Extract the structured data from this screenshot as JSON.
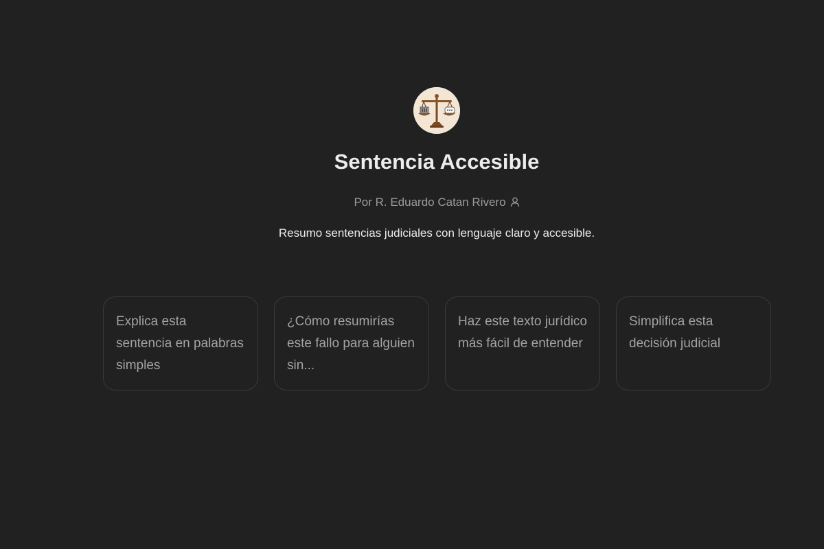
{
  "gpt": {
    "name": "Sentencia Accesible",
    "author": "Por R. Eduardo Catan Rivero",
    "description": "Resumo sentencias judiciales con lenguaje claro y accesible.",
    "avatar_icon": "scales-of-justice-icon"
  },
  "conversation_starters": [
    {
      "label": "Explica esta sentencia en palabras simples"
    },
    {
      "label": "¿Cómo resumirías este fallo para alguien sin..."
    },
    {
      "label": "Haz este texto jurídico más fácil de entender"
    },
    {
      "label": "Simplifica esta decisión judicial"
    }
  ],
  "colors": {
    "background": "#212121",
    "card_border": "#3a3a3a",
    "text_primary": "#ececec",
    "text_secondary": "#9b9b9b"
  }
}
